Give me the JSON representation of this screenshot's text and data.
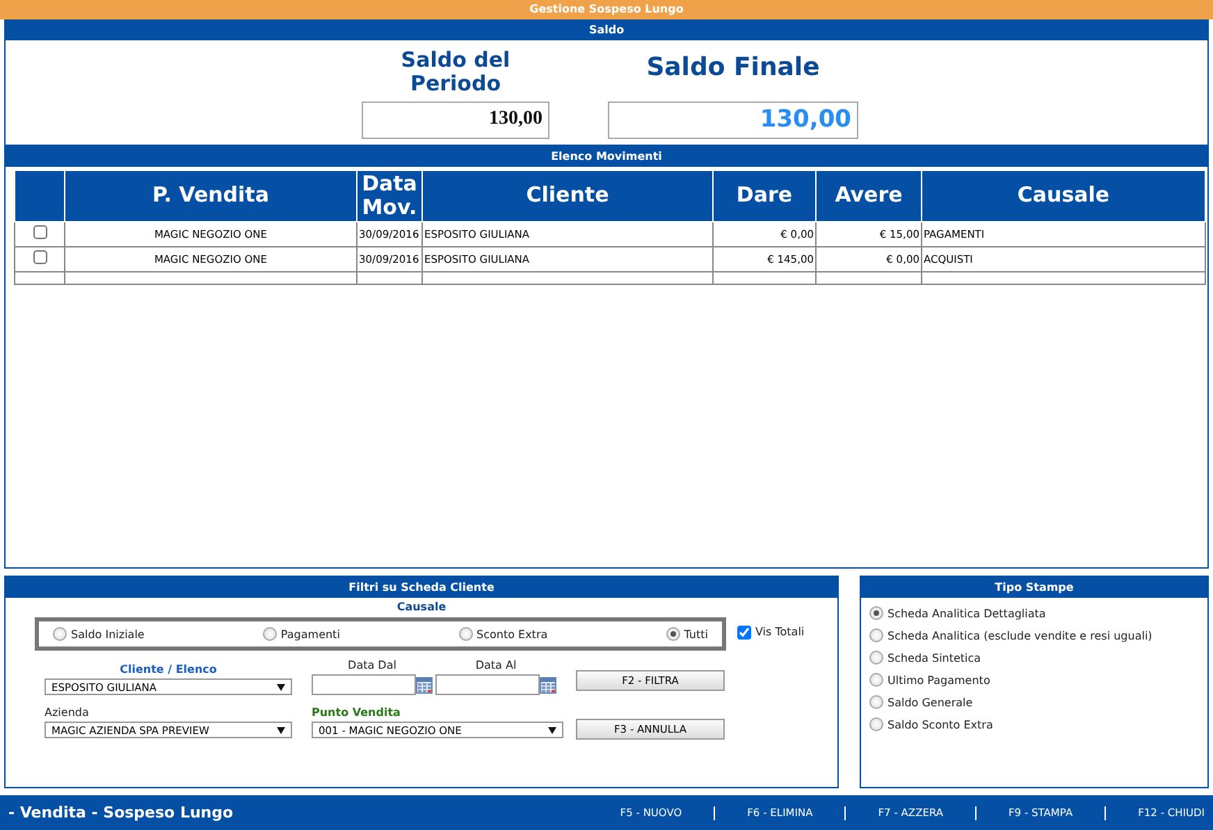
{
  "window": {
    "title": "Gestione Sospeso Lungo"
  },
  "saldo": {
    "header": "Saldo",
    "periodo_label": "Saldo del Periodo",
    "periodo_value": "130,00",
    "finale_label": "Saldo Finale",
    "finale_value": "130,00"
  },
  "movimenti": {
    "header": "Elenco Movimenti",
    "columns": [
      "P. Vendita",
      "Data Mov.",
      "Cliente",
      "Dare",
      "Avere",
      "Causale"
    ],
    "rows": [
      {
        "checked": false,
        "cells": [
          "MAGIC NEGOZIO ONE",
          "30/09/2016",
          "ESPOSITO GIULIANA",
          "€ 0,00",
          "€ 15,00",
          "PAGAMENTI"
        ]
      },
      {
        "checked": false,
        "cells": [
          "MAGIC NEGOZIO ONE",
          "30/09/2016",
          "ESPOSITO GIULIANA",
          "€ 145,00",
          "€ 0,00",
          "ACQUISTI"
        ]
      }
    ]
  },
  "filtri": {
    "header": "Filtri su Scheda Cliente",
    "causale_label": "Causale",
    "causale_options": [
      {
        "label": "Saldo Iniziale",
        "selected": false
      },
      {
        "label": "Pagamenti",
        "selected": false
      },
      {
        "label": "Sconto Extra",
        "selected": false
      },
      {
        "label": "Tutti",
        "selected": true
      }
    ],
    "vis_totali": {
      "label": "Vis Totali",
      "checked": true
    },
    "cliente_label": "Cliente / Elenco",
    "cliente_value": "ESPOSITO GIULIANA",
    "data_dal_label": "Data Dal",
    "data_al_label": "Data Al",
    "azienda_label": "Azienda",
    "azienda_value": "MAGIC AZIENDA SPA PREVIEW",
    "punto_vendita_label": "Punto Vendita",
    "punto_vendita_value": "001 - MAGIC NEGOZIO ONE",
    "buttons": [
      "F2 - FILTRA",
      "F3 - ANNULLA"
    ]
  },
  "tipo_stampe": {
    "header": "Tipo Stampe",
    "options": [
      {
        "label": "Scheda Analitica Dettagliata",
        "selected": true
      },
      {
        "label": "Scheda Analitica (esclude vendite e resi uguali)",
        "selected": false
      },
      {
        "label": "Scheda Sintetica",
        "selected": false
      },
      {
        "label": "Ultimo Pagamento",
        "selected": false
      },
      {
        "label": "Saldo Generale",
        "selected": false
      },
      {
        "label": "Saldo Sconto Extra",
        "selected": false
      }
    ]
  },
  "status_bar": {
    "title": "- Vendita - Sospeso Lungo",
    "actions": [
      "F5 - NUOVO",
      "F6 - ELIMINA",
      "F7 - AZZERA",
      "F9 - STAMPA",
      "F12 - CHIUDI"
    ]
  }
}
